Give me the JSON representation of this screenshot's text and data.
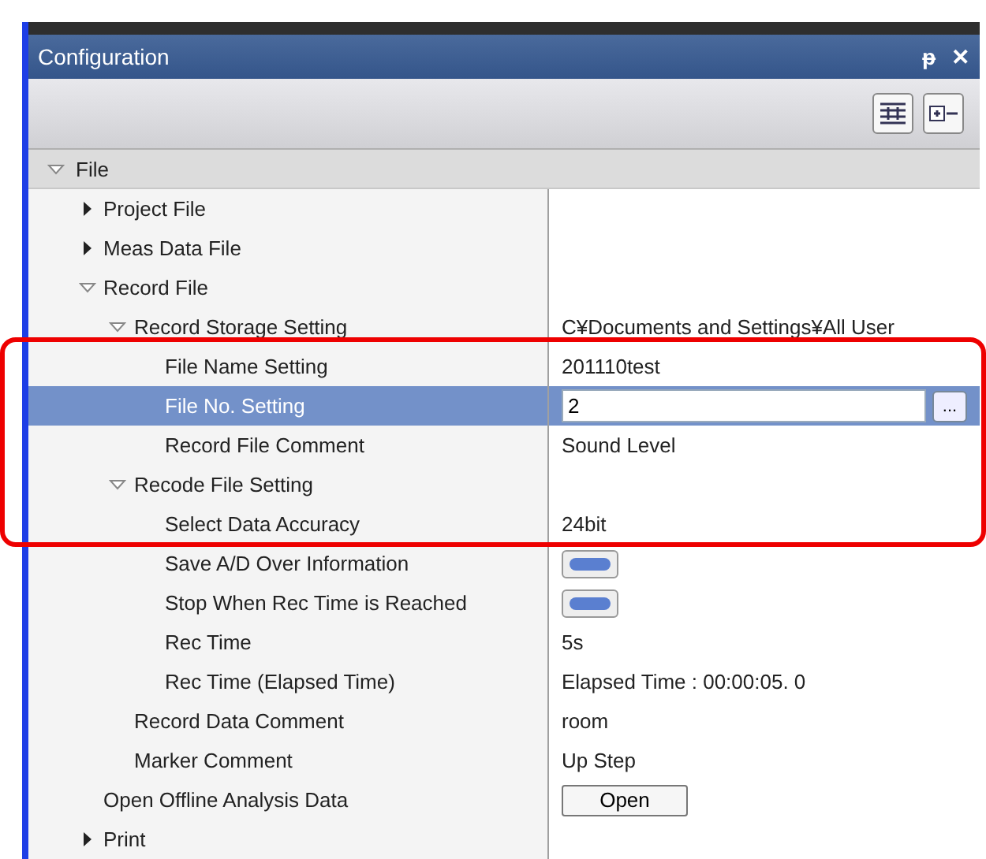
{
  "window": {
    "title": "Configuration",
    "pin": "ᵽ",
    "close": "✕"
  },
  "highlight_frame": true,
  "tree": [
    {
      "label": "File",
      "expanded": true,
      "selected": false,
      "children": [
        {
          "label": "Project File",
          "expanded": false,
          "selected": false
        },
        {
          "label": "Meas Data File",
          "expanded": false,
          "selected": false
        },
        {
          "label": "Record File",
          "expanded": true,
          "selected": false,
          "children": [
            {
              "label": "Record Storage Setting",
              "expanded": true,
              "selected": false,
              "value": {
                "kind": "text",
                "text": "C¥Documents and Settings¥All User"
              },
              "children": [
                {
                  "label": "File Name Setting",
                  "selected": false,
                  "value": {
                    "kind": "text",
                    "text": "201110test"
                  }
                },
                {
                  "label": "File No. Setting",
                  "selected": true,
                  "value": {
                    "kind": "editor",
                    "text": "2",
                    "button": "..."
                  }
                },
                {
                  "label": "Record File Comment",
                  "selected": false,
                  "value": {
                    "kind": "text",
                    "text": "Sound Level"
                  }
                }
              ]
            },
            {
              "label": "Recode File Setting",
              "expanded": true,
              "selected": false,
              "children": [
                {
                  "label": "Select Data Accuracy",
                  "selected": false,
                  "value": {
                    "kind": "text",
                    "text": "24bit"
                  }
                },
                {
                  "label": "Save A/D Over Information",
                  "selected": false,
                  "value": {
                    "kind": "toggle",
                    "on": true
                  }
                },
                {
                  "label": "Stop When Rec Time is Reached",
                  "selected": false,
                  "value": {
                    "kind": "toggle",
                    "on": true
                  }
                },
                {
                  "label": "Rec Time",
                  "selected": false,
                  "value": {
                    "kind": "text",
                    "text": "5s"
                  }
                },
                {
                  "label": "Rec Time (Elapsed Time)",
                  "selected": false,
                  "value": {
                    "kind": "text",
                    "text": "Elapsed Time : 00:00:05. 0"
                  }
                }
              ]
            },
            {
              "label": "Record Data Comment",
              "selected": false,
              "value": {
                "kind": "text",
                "text": "room"
              }
            },
            {
              "label": "Marker Comment",
              "selected": false,
              "value": {
                "kind": "text",
                "text": "Up Step"
              }
            }
          ]
        },
        {
          "label": "Open Offline Analysis Data",
          "selected": false,
          "value": {
            "kind": "button",
            "text": "Open"
          }
        },
        {
          "label": "Print",
          "expanded": false,
          "selected": false
        }
      ]
    }
  ]
}
